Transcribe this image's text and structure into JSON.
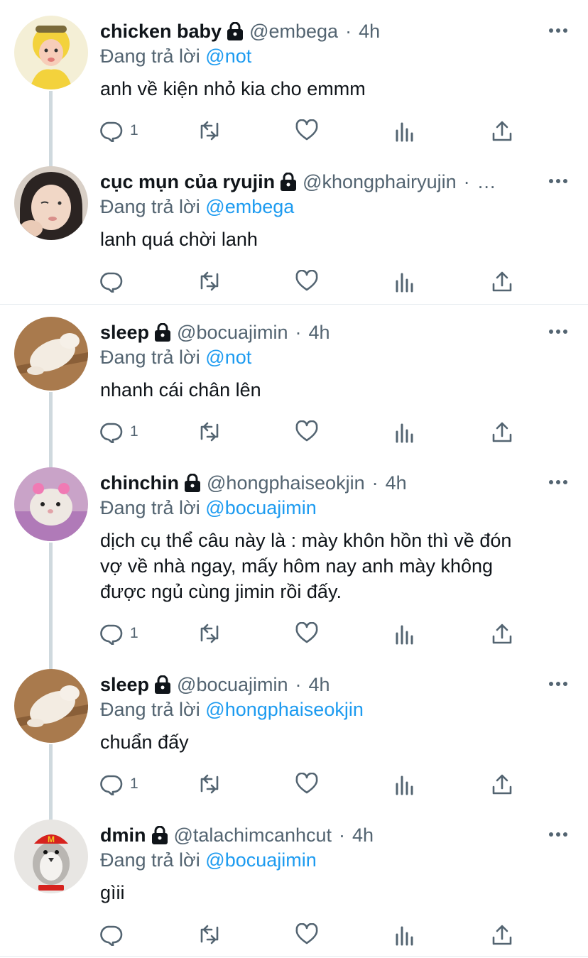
{
  "tweets": [
    {
      "name": "chicken baby",
      "handle": "@embega",
      "time": "4h",
      "reply_prefix": "Đang trả lời",
      "reply_to": "@not",
      "text": "anh về kiện nhỏ kia cho emmm",
      "reply_count": "1"
    },
    {
      "name": "cục mụn của ryujin",
      "handle": "@khongphairyujin",
      "time": "…",
      "reply_prefix": "Đang trả lời",
      "reply_to": "@embega",
      "text": "lanh quá chời lanh",
      "reply_count": ""
    },
    {
      "name": "sleep",
      "handle": "@bocuajimin",
      "time": "4h",
      "reply_prefix": "Đang trả lời",
      "reply_to": "@not",
      "text": "nhanh cái chân lên",
      "reply_count": "1"
    },
    {
      "name": "chinchin",
      "handle": "@hongphaiseokjin",
      "time": "4h",
      "reply_prefix": "Đang trả lời",
      "reply_to": "@bocuajimin",
      "text": "dịch cụ thể câu này là : mày khôn hồn thì về đón vợ về nhà ngay, mấy hôm nay anh mày không được ngủ cùng jimin rồi đấy.",
      "reply_count": "1"
    },
    {
      "name": "sleep",
      "handle": "@bocuajimin",
      "time": "4h",
      "reply_prefix": "Đang trả lời",
      "reply_to": "@hongphaiseokjin",
      "text": "chuẩn đấy",
      "reply_count": "1"
    },
    {
      "name": "dmin",
      "handle": "@talachimcanhcut",
      "time": "4h",
      "reply_prefix": "Đang trả lời",
      "reply_to": "@bocuajimin",
      "text": "gìii",
      "reply_count": ""
    }
  ],
  "icons": {
    "reply": "reply-icon",
    "retweet": "retweet-icon",
    "like": "like-icon",
    "views": "views-icon",
    "share": "share-icon",
    "more": "more-icon",
    "lock": "lock-icon"
  },
  "colors": {
    "link": "#1d9bf0",
    "muted": "#536471",
    "text": "#0f1419",
    "thread": "#cfd9de"
  }
}
